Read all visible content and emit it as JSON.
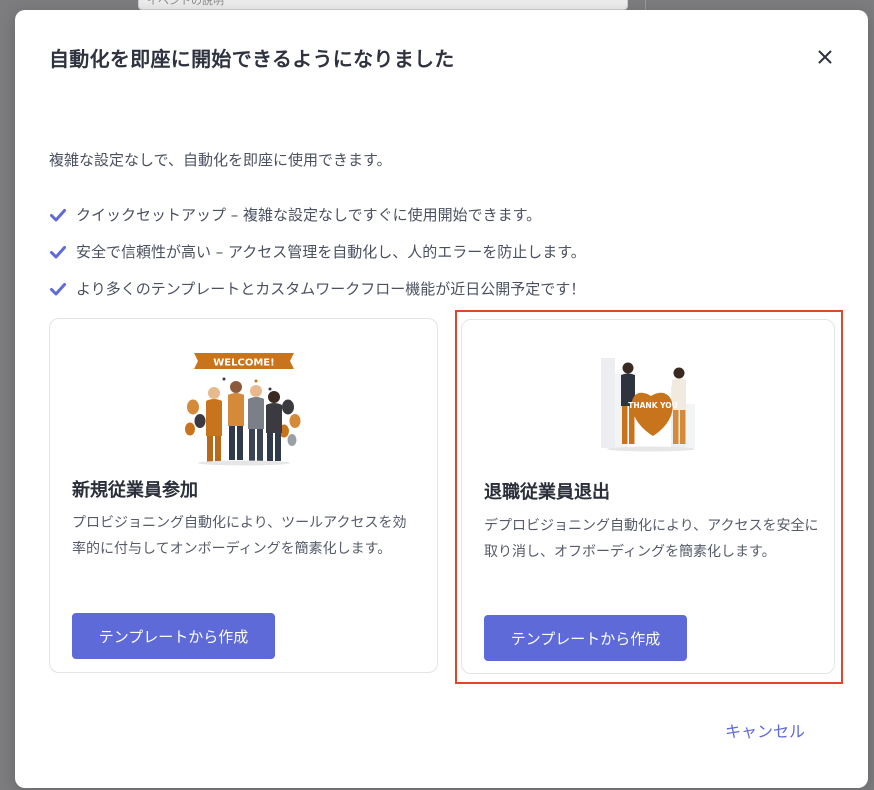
{
  "background": {
    "field_text": "イベントの説明"
  },
  "modal": {
    "title": "自動化を即座に開始できるようになりました",
    "intro": "複雑な設定なしで、自動化を即座に使用できます。",
    "features": [
      "クイックセットアップ – 複雑な設定なしですぐに使用開始できます。",
      "安全で信頼性が高い – アクセス管理を自動化し、人的エラーを防止します。",
      "より多くのテンプレートとカスタムワークフロー機能が近日公開予定です！"
    ],
    "cards": [
      {
        "banner_text": "WELCOME!",
        "title": "新規従業員参加",
        "description": "プロビジョニング自動化により、ツールアクセスを効率的に付与してオンボーディングを簡素化します。",
        "button_label": "テンプレートから作成"
      },
      {
        "heart_text": "THANK YOU",
        "title": "退職従業員退出",
        "description": "デプロビジョニング自動化により、アクセスを安全に取り消し、オフボーディングを簡素化します。",
        "button_label": "テンプレートから作成"
      }
    ],
    "cancel_label": "キャンセル"
  },
  "colors": {
    "accent": "#5e6ad8",
    "highlight": "#e0462a",
    "illustration_orange": "#c8741c"
  },
  "icons": {
    "close": "close-icon",
    "check": "check-icon"
  }
}
